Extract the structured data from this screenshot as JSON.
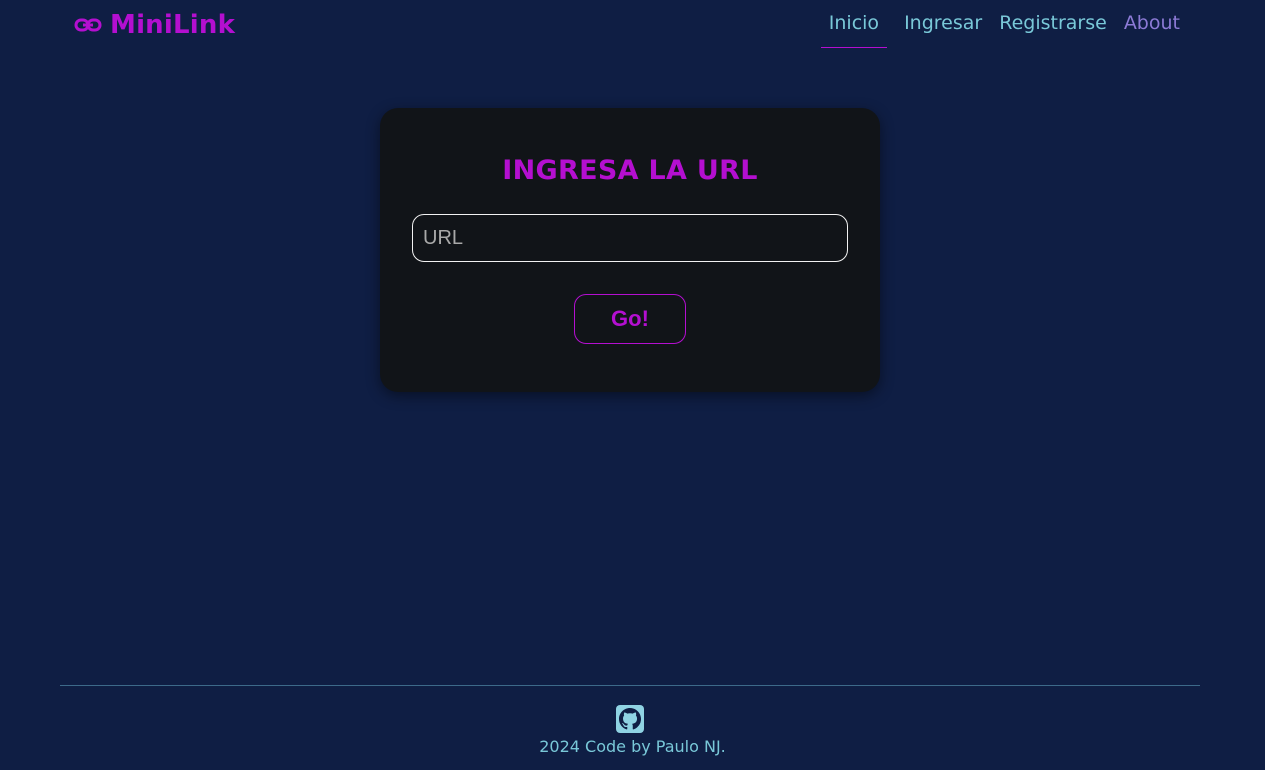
{
  "brand": {
    "name": "MiniLink",
    "icon": "link-icon",
    "color": "#b40fd0"
  },
  "nav": {
    "items": [
      {
        "label": "Inicio",
        "active": true
      },
      {
        "label": "Ingresar",
        "active": false
      },
      {
        "label": "Registrarse",
        "active": false
      },
      {
        "label": "About",
        "active": false
      }
    ]
  },
  "form": {
    "title": "INGRESA LA URL",
    "url_placeholder": "URL",
    "url_value": "",
    "submit_label": "Go!"
  },
  "footer": {
    "icon": "github-icon",
    "text": "2024 Code by Paulo NJ."
  },
  "colors": {
    "background": "#0f1e44",
    "card": "#111418",
    "accent": "#b40fd0",
    "nav_text": "#79c8d8",
    "about_text": "#8c7ad6"
  }
}
